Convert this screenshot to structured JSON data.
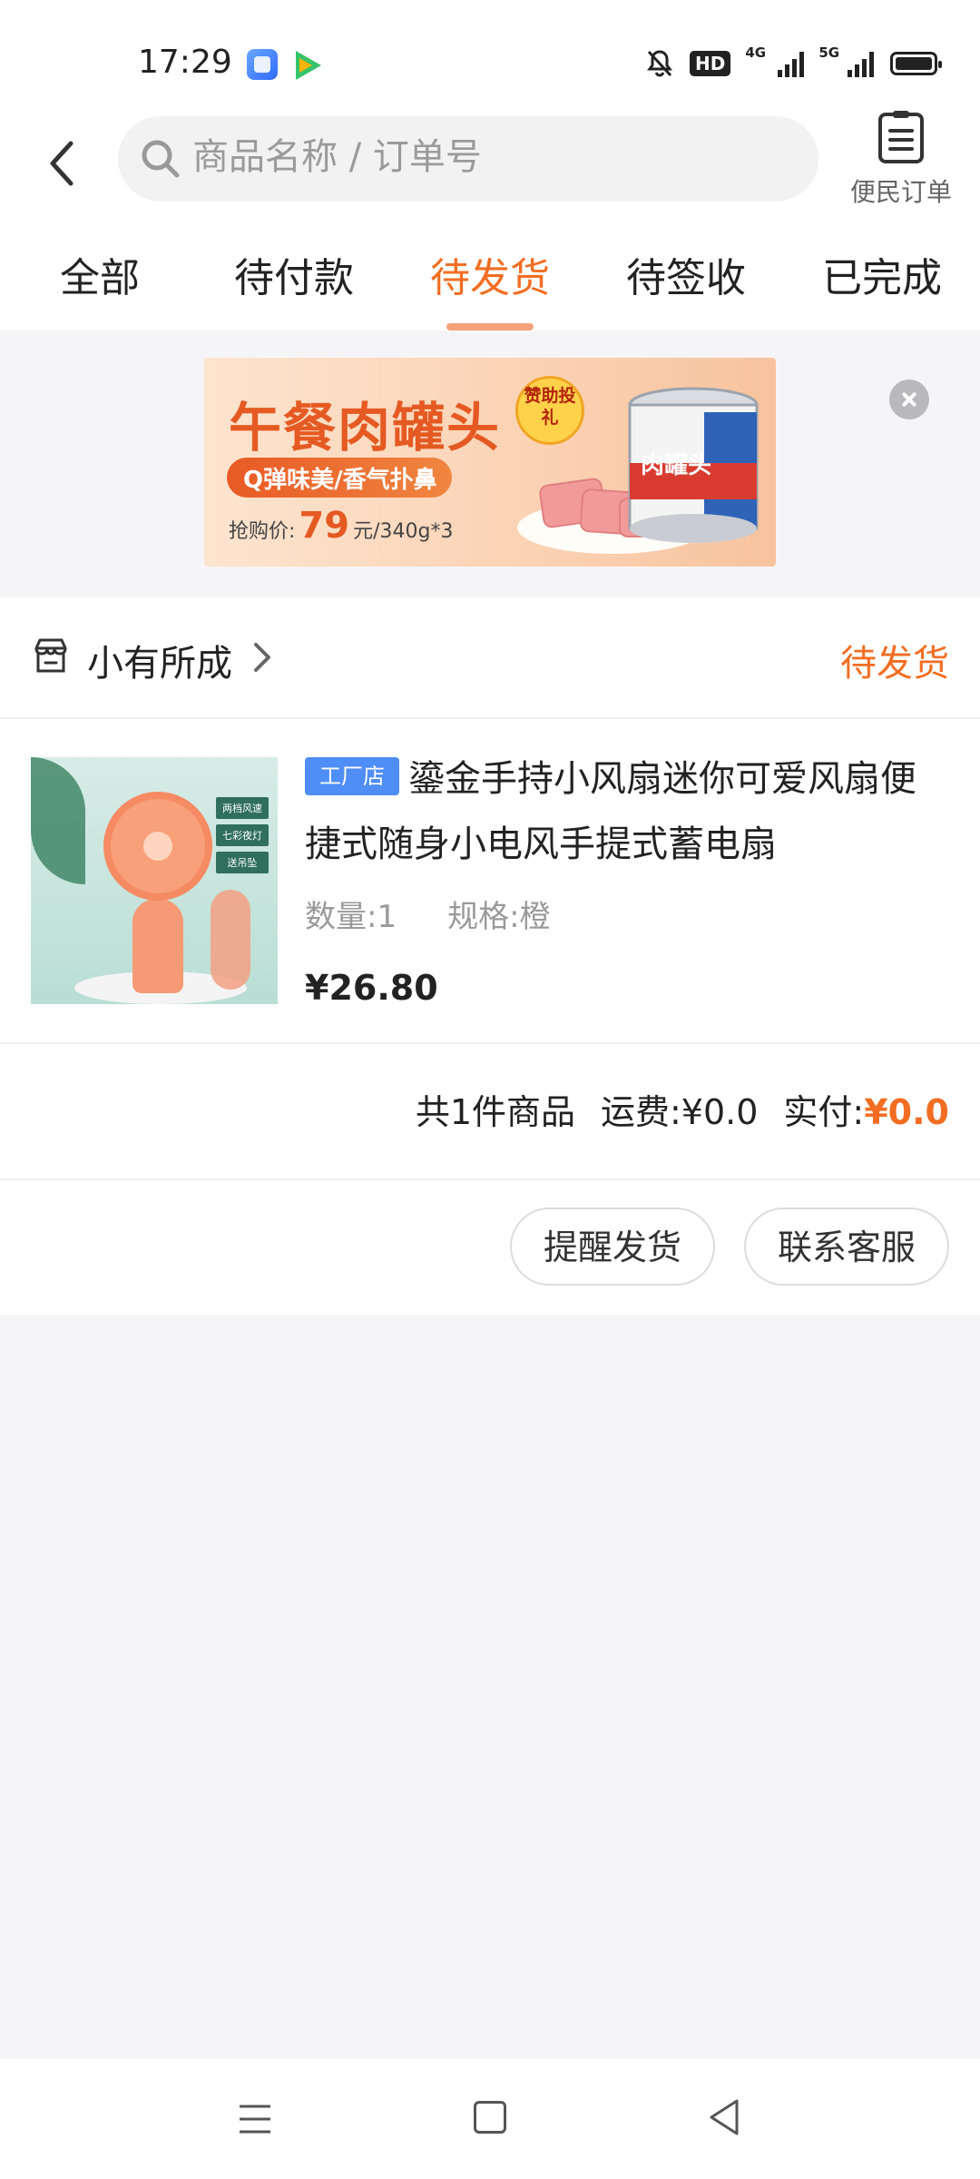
{
  "status_bar": {
    "time": "17:29",
    "hd_badge": "HD",
    "net1": "4G",
    "net2": "5G"
  },
  "header": {
    "search_placeholder": "商品名称 / 订单号",
    "orders_label": "便民订单"
  },
  "tabs": [
    {
      "label": "全部",
      "active": false
    },
    {
      "label": "待付款",
      "active": false
    },
    {
      "label": "待发货",
      "active": true
    },
    {
      "label": "待签收",
      "active": false
    },
    {
      "label": "已完成",
      "active": false
    }
  ],
  "banner": {
    "title": "午餐肉罐头",
    "badge": "赞助投礼",
    "slogan": "Q弹味美/香气扑鼻",
    "price_prefix": "抢购价:",
    "price": "79",
    "price_suffix": "元/340g*3",
    "can_text": "肉罐头"
  },
  "order": {
    "shop_name": "小有所成",
    "status": "待发货",
    "product": {
      "tag": "工厂店",
      "title": "鎏金手持小风扇迷你可爱风扇便捷式随身小电风手提式蓄电扇",
      "quantity": "数量:1",
      "spec": "规格:橙",
      "price": "¥26.80",
      "image_labels": [
        "两档风速",
        "七彩夜灯",
        "送吊坠"
      ]
    },
    "summary": {
      "count": "共1件商品",
      "shipping": "运费:¥0.0",
      "paid_label": "实付:",
      "paid_value": "¥0.0"
    },
    "buttons": {
      "remind": "提醒发货",
      "contact": "联系客服"
    }
  },
  "colors": {
    "accent": "#f26d22",
    "tag_blue": "#4f8ef7",
    "page_bg": "#f5f5f7"
  }
}
